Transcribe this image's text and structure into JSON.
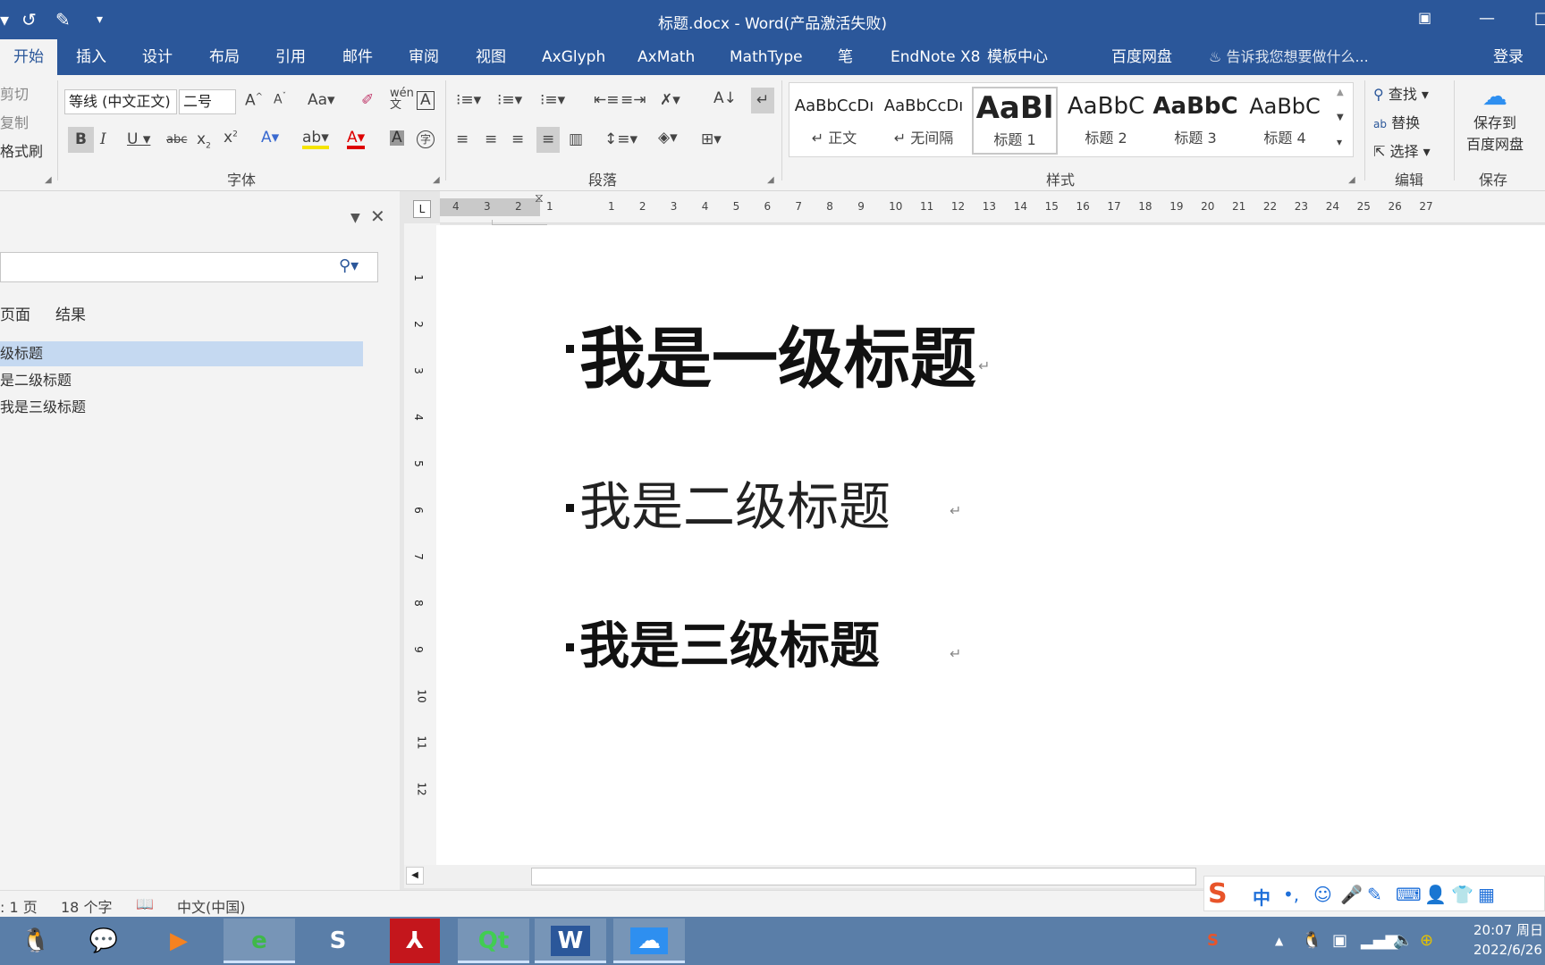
{
  "window": {
    "title": "标题.docx - Word(产品激活失败)",
    "restore_icon": "ribbon-display-icon",
    "min_label": "—",
    "max_label": "□"
  },
  "tabs": [
    {
      "label": "开始"
    },
    {
      "label": "插入"
    },
    {
      "label": "设计"
    },
    {
      "label": "布局"
    },
    {
      "label": "引用"
    },
    {
      "label": "邮件"
    },
    {
      "label": "审阅"
    },
    {
      "label": "视图"
    },
    {
      "label": "AxGlyph"
    },
    {
      "label": "AxMath"
    },
    {
      "label": "MathType"
    },
    {
      "label": "笔"
    },
    {
      "label": "EndNote X8"
    },
    {
      "label": "模板中心"
    },
    {
      "label": "百度网盘"
    }
  ],
  "tellme": "告诉我您想要做什么...",
  "login": "登录",
  "clipboard": {
    "cut": "剪切",
    "copy": "复制",
    "painter": "格式刷"
  },
  "font": {
    "name": "等线 (中文正文)",
    "size": "二号",
    "group_label": "字体"
  },
  "paragraph": {
    "group_label": "段落"
  },
  "styles": {
    "group_label": "样式",
    "items": [
      {
        "preview": "AaBbCcDı",
        "name": "↵ 正文"
      },
      {
        "preview": "AaBbCcDı",
        "name": "↵ 无间隔"
      },
      {
        "preview": "AaBl",
        "name": "标题 1"
      },
      {
        "preview": "AaBbC",
        "name": "标题 2"
      },
      {
        "preview": "AaBbC",
        "name": "标题 3"
      },
      {
        "preview": "AaBbC",
        "name": "标题 4"
      }
    ]
  },
  "editing": {
    "find": "查找",
    "replace": "替换",
    "select": "选择",
    "group_label": "编辑"
  },
  "save": {
    "line1": "保存到",
    "line2": "百度网盘",
    "group_label": "保存"
  },
  "nav": {
    "tab_pages": "页面",
    "tab_results": "结果",
    "items": [
      "级标题",
      "是二级标题",
      "我是三级标题"
    ]
  },
  "ruler": {
    "left": [
      "4",
      "3",
      "2",
      "1"
    ],
    "right": [
      "1",
      "2",
      "3",
      "4",
      "5",
      "6",
      "7",
      "8",
      "9",
      "10",
      "11",
      "12",
      "13",
      "14",
      "15",
      "16",
      "17",
      "18",
      "19",
      "20",
      "21",
      "22",
      "23",
      "24",
      "25",
      "26",
      "27"
    ],
    "vertical": [
      "1",
      "2",
      "3",
      "4",
      "5",
      "6",
      "7",
      "8",
      "9",
      "10",
      "11",
      "12"
    ]
  },
  "document": {
    "h1": "我是一级标题",
    "h2": "我是二级标题",
    "h3": "我是三级标题",
    "para_mark": "↵"
  },
  "status": {
    "page": ": 1 页",
    "words": "18 个字",
    "lang": "中文(中国)"
  },
  "ime": {
    "lang": "中",
    "punct": "•,"
  },
  "clock": {
    "time": "20:07 周日",
    "date": "2022/6/26"
  },
  "colors": {
    "word_blue": "#2b579a",
    "taskbar": "#5a7ea8"
  }
}
